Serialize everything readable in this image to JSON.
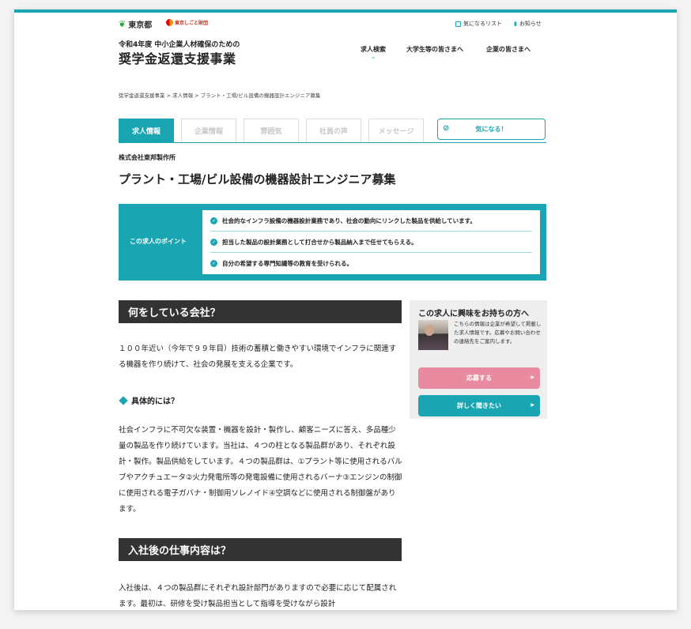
{
  "header": {
    "logo_tokyo": "東京都",
    "logo_shigoto": "東京しごと財団",
    "util_favorites": "気になるリスト",
    "util_news": "お知らせ",
    "sub_title": "令和4年度 中小企業人材確保のための",
    "main_title": "奨学金返還支援事業",
    "nav": [
      "求人検索",
      "大学生等の皆さまへ",
      "企業の皆さまへ"
    ]
  },
  "breadcrumb": "奨学金返還支援事業 > 求人情報 > プラント・工場/ビル設備の機器設計エンジニア募集",
  "tabs": [
    "求人情報",
    "企業情報",
    "雰囲気",
    "社員の声",
    "メッセージ"
  ],
  "favorite_button": "気になる！",
  "company_name": "株式会社東邦製作所",
  "job_title": "プラント・工場/ビル設備の機器設計エンジニア募集",
  "points": {
    "label": "この求人のポイント",
    "items": [
      "社会的なインフラ設備の機器設計業務であり、社会の動向にリンクした製品を供給しています。",
      "担当した製品の設計業務として打合せから製品納入まで任せてもらえる。",
      "自分の希望する専門知識等の教育を受けられる。"
    ]
  },
  "section1": {
    "heading": "何をしている会社？",
    "intro": "１００年近い（今年で９９年目）技術の蓄積と働きやすい環境でインフラに関連する機器を作り続けて、社会の発展を支える企業です。",
    "subheading": "具体的には？",
    "detail": "社会インフラに不可欠な装置・機器を設計・製作し、顧客ニーズに答え、多品種少量の製品を作り続けています。当社は、４つの柱となる製品群があり、それぞれ設計・製作。製品供給をしています。４つの製品群は、①プラント等に使用されるバルブやアクチュエータ②火力発電所等の発電設備に使用されるバーナ③エンジンの制御に使用される電子ガバナ・制御用ソレノイド④空調などに使用される制御盤があります。"
  },
  "section2": {
    "heading": "入社後の仕事内容は？",
    "intro": "入社後は、４つの製品群にそれぞれ設計部門がありますので必要に応じて配属されます。最初は、研修を受け製品担当として指導を受けながら設計"
  },
  "sidebar": {
    "title": "この求人に興味をお持ちの方へ",
    "text": "こちらの情報は企業が希望して掲載した求人情報です。応募やお問い合わせの連絡先をご案内します。",
    "apply_button": "応募する",
    "detail_button": "詳しく聞きたい"
  }
}
